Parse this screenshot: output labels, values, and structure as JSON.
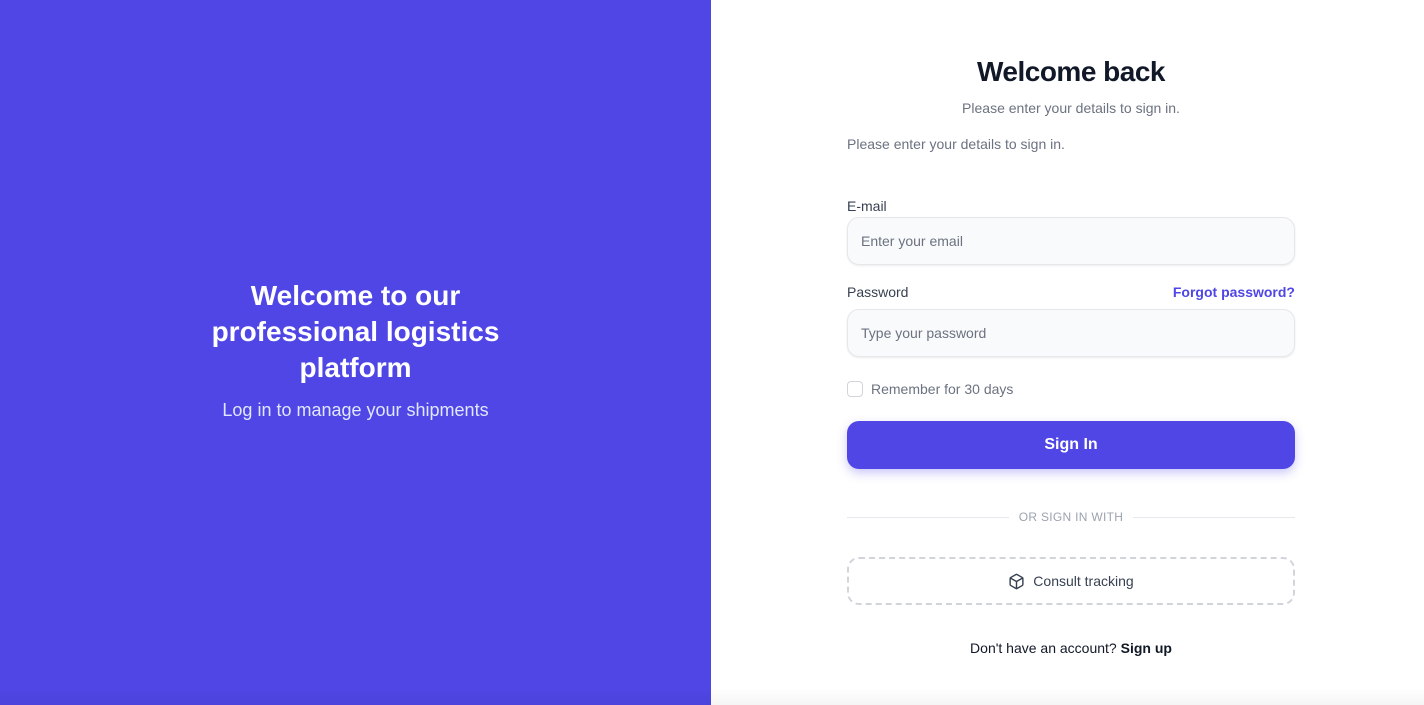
{
  "hero": {
    "title": "Welcome to our professional logistics platform",
    "subtitle": "Log in to manage your shipments",
    "background_color": "#4f46e5"
  },
  "form": {
    "title": "Welcome back",
    "subtitle": "Please enter your details to sign in.",
    "description": "Please enter your details to sign in.",
    "email": {
      "label": "E-mail",
      "placeholder": "Enter your email",
      "value": ""
    },
    "password": {
      "label": "Password",
      "placeholder": "Type your password",
      "value": "",
      "forgot_label": "Forgot password?"
    },
    "remember": {
      "label": "Remember for 30 days",
      "checked": false
    },
    "sign_in_label": "Sign In",
    "divider_label": "OR SIGN IN WITH",
    "tracking": {
      "label": "Consult tracking",
      "icon": "package-icon"
    },
    "signup": {
      "prompt": "Don't have an account?",
      "link_label": "Sign up"
    }
  },
  "colors": {
    "accent": "#4f46e5",
    "text_dark": "#111827",
    "text_muted": "#6b7280"
  }
}
